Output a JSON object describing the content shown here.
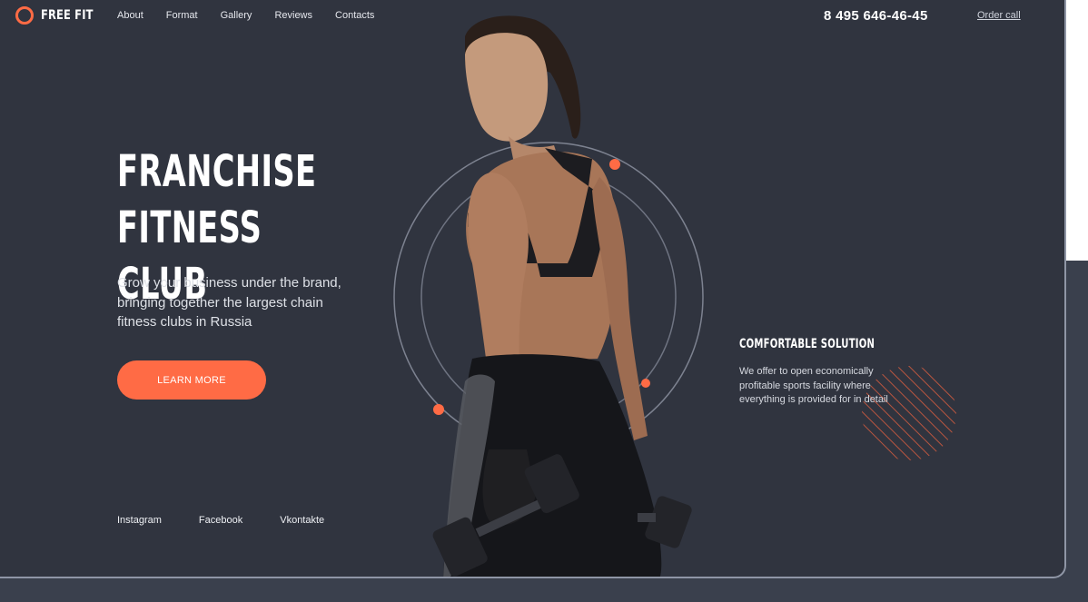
{
  "brand": {
    "name": "FREE FIT",
    "accent": "#ff6b45"
  },
  "nav": [
    "About",
    "Format",
    "Gallery",
    "Reviews",
    "Contacts"
  ],
  "header": {
    "phone": "8 495 646-46-45",
    "order_call": "Order call"
  },
  "hero": {
    "title_line1": "FRANCHISE",
    "title_line2": "FITNESS CLUB",
    "subtitle": "Grow your business under the brand, bringing together the largest chain fitness clubs in Russia",
    "cta": "LEARN MORE"
  },
  "social": [
    "Instagram",
    "Facebook",
    "Vkontakte"
  ],
  "side": {
    "title": "COMFORTABLE SOLUTION",
    "text": "We offer to open economically profitable sports facility where everything is provided for in detail"
  },
  "colors": {
    "background": "#30343f",
    "outer": "#3a404d",
    "accent": "#ff6b45"
  }
}
